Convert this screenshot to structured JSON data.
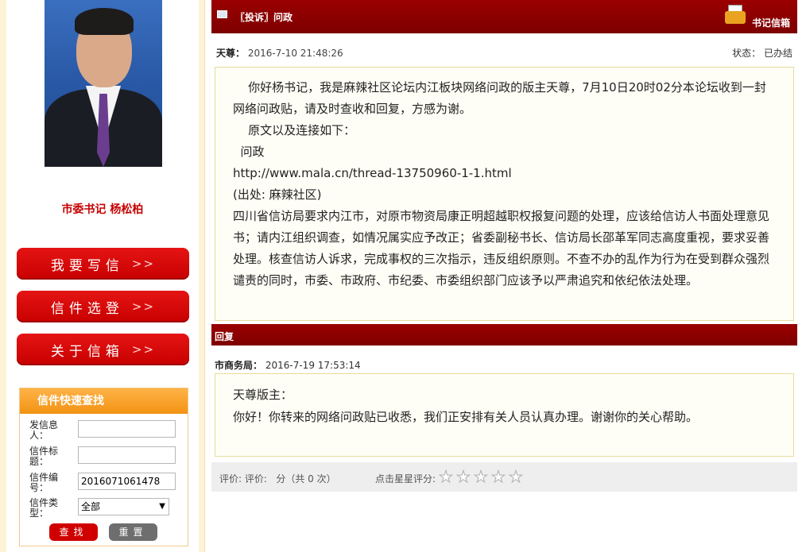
{
  "sidebar": {
    "secretary_label": "市委书记  杨松柏",
    "buttons": [
      {
        "label": "我要写信",
        "arrow": ">>"
      },
      {
        "label": "信件选登",
        "arrow": ">>"
      },
      {
        "label": "关于信箱",
        "arrow": ">>"
      }
    ],
    "search": {
      "title": "信件快速查找",
      "sender_label": "发信息人：",
      "sender_value": "",
      "title_label": "信件标题：",
      "title_value": "",
      "number_label": "信件编号：",
      "number_value": "2016071061478",
      "type_label": "信件类型：",
      "type_value": "全部",
      "find_label": "查找",
      "reset_label": "重置"
    }
  },
  "letter": {
    "header_title": "〖投诉〗问政",
    "mailbox_label": "书记信箱",
    "author": "天尊：",
    "date": "2016-7-10 21:48:26",
    "status_label": "状态：",
    "status_value": "已办结",
    "body": [
      "    你好杨书记，我是麻辣社区论坛内江板块网络问政的版主天尊，7月10日20时02分本论坛收到一封网络问政贴，请及时查收和回复，方感为谢。",
      "    原文以及连接如下：",
      "  问政",
      "http://www.mala.cn/thread-13750960-1-1.html",
      "(出处: 麻辣社区)",
      "四川省信访局要求内江市，对原市物资局康正明超越职权报复问题的处理，应该给信访人书面处理意见书；请内江组织调查，如情况属实应予改正；省委副秘书长、信访局长邵革军同志高度重视，要求妥善处理。核查信访人诉求，完成事权的三次指示，违反组织原则。不查不办的乱作为行为在受到群众强烈谴责的同时，市委、市政府、市纪委、市委组织部门应该予以严肃追究和依纪依法处理。"
    ]
  },
  "reply": {
    "header_title": "回复",
    "author": "市商务局：",
    "date": "2016-7-19 17:53:14",
    "body": [
      "天尊版主：",
      "你好！你转来的网络问政贴已收悉，我们正安排有关人员认真办理。谢谢你的关心帮助。"
    ]
  },
  "rating": {
    "summary": "评价: 评价:   分（共 0 次）",
    "prompt": "点击星星评分:",
    "star_count": 5,
    "value": 0
  }
}
